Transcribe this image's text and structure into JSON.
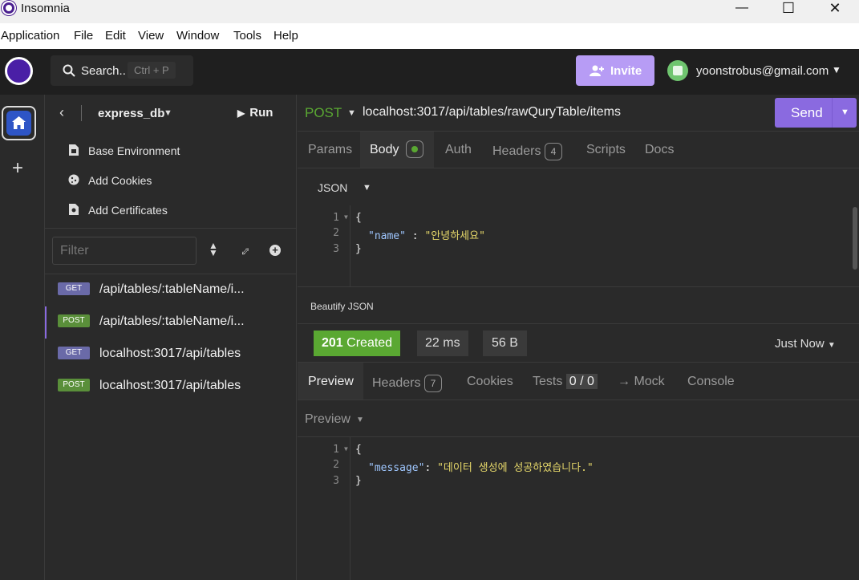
{
  "window": {
    "title": "Insomnia",
    "min": "—",
    "max": "☐",
    "close": "✕"
  },
  "menu": [
    "Application",
    "File",
    "Edit",
    "View",
    "Window",
    "Tools",
    "Help"
  ],
  "header": {
    "search_label": "Search..",
    "search_shortcut": "Ctrl + P",
    "invite_label": "Invite",
    "user_email": "yoonstrobus@gmail.com"
  },
  "sidebar": {
    "project": "express_db",
    "run_label": "Run",
    "menu_items": [
      {
        "label": "Base Environment",
        "icon": "environment-icon"
      },
      {
        "label": "Add Cookies",
        "icon": "cookie-icon"
      },
      {
        "label": "Add Certificates",
        "icon": "certificate-icon"
      }
    ],
    "filter_placeholder": "Filter",
    "requests": [
      {
        "method": "GET",
        "name": "/api/tables/:tableName/i..."
      },
      {
        "method": "POST",
        "name": "/api/tables/:tableName/i...",
        "active": true
      },
      {
        "method": "GET",
        "name": "localhost:3017/api/tables"
      },
      {
        "method": "POST",
        "name": "localhost:3017/api/tables"
      }
    ]
  },
  "request": {
    "method": "POST",
    "url": "localhost:3017/api/tables/rawQuryTable/items",
    "send_label": "Send",
    "tabs": {
      "params": "Params",
      "body": "Body",
      "auth": "Auth",
      "headers": "Headers",
      "headers_count": "4",
      "scripts": "Scripts",
      "docs": "Docs"
    },
    "body_type": "JSON",
    "body_lines": [
      {
        "num": "1",
        "text": "{"
      },
      {
        "num": "2",
        "key": "\"name\"",
        "sep": " : ",
        "value": "\"안녕하세요\""
      },
      {
        "num": "3",
        "text": "}"
      }
    ],
    "beautify_label": "Beautify JSON"
  },
  "response": {
    "status": "201 Created",
    "time": "22 ms",
    "size": "56 B",
    "timestamp": "Just Now",
    "tabs": {
      "preview": "Preview",
      "headers": "Headers",
      "headers_count": "7",
      "cookies": "Cookies",
      "tests": "Tests",
      "tests_count": "0 / 0",
      "mock": "→ Mock",
      "console": "Console"
    },
    "preview_mode": "Preview",
    "body_lines": [
      {
        "num": "1",
        "text": "{"
      },
      {
        "num": "2",
        "key": "\"message\"",
        "sep": ": ",
        "value": "\"데이터 생성에 성공하였습니다.\""
      },
      {
        "num": "3",
        "text": "}"
      }
    ]
  },
  "colors": {
    "accent": "#8a6ae0",
    "status_ok": "#5aa832",
    "post": "#5aa832",
    "get": "#6a6aa8"
  }
}
